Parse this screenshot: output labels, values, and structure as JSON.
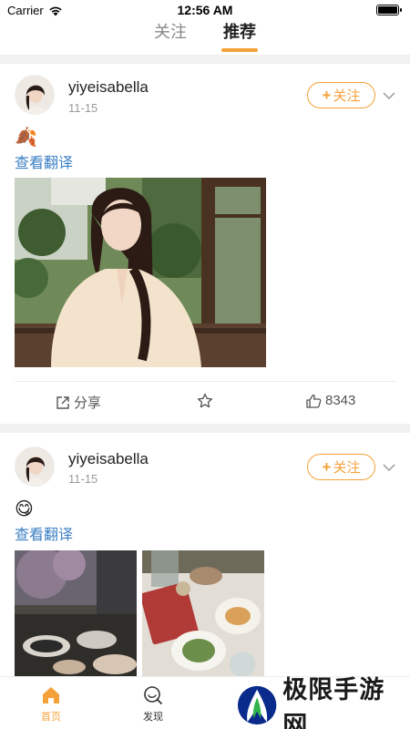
{
  "status_bar": {
    "carrier": "Carrier",
    "time": "12:56 AM",
    "battery_level": 1.0
  },
  "top_tabs": [
    {
      "label": "关注",
      "active": false
    },
    {
      "label": "推荐",
      "active": true
    }
  ],
  "accent_color": "#f5a13a",
  "link_color": "#3b7fc4",
  "posts": [
    {
      "username": "yiyeisabella",
      "date": "11-15",
      "follow_label": "关注",
      "emoji": "🍂",
      "translate_label": "查看翻译",
      "actions": {
        "share_label": "分享",
        "like_count": "8343"
      }
    },
    {
      "username": "yiyeisabella",
      "date": "11-15",
      "follow_label": "关注",
      "emoji": "😋",
      "translate_label": "查看翻译"
    }
  ],
  "bottom_tabs": [
    {
      "label": "首页",
      "icon": "home-icon",
      "active": true
    },
    {
      "label": "发现",
      "icon": "discover-icon",
      "active": false
    }
  ],
  "watermark": {
    "text": "极限手游网"
  }
}
